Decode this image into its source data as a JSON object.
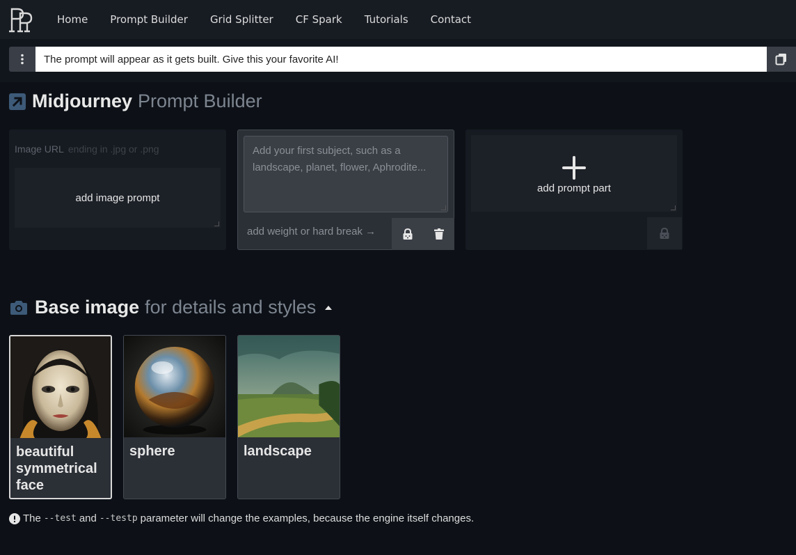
{
  "nav": {
    "items": [
      "Home",
      "Prompt Builder",
      "Grid Splitter",
      "CF Spark",
      "Tutorials",
      "Contact"
    ]
  },
  "prompt_bar": {
    "text": "The prompt will appear as it gets built. Give this your favorite AI!"
  },
  "builder": {
    "title_strong": "Midjourney",
    "title_muted": "Prompt Builder",
    "image_card": {
      "url_label": "Image URL",
      "url_placeholder": "ending in .jpg or .png",
      "add_label": "add image prompt"
    },
    "subject_card": {
      "placeholder": "Add your first subject, such as a landscape, planet, flower, Aphrodite...",
      "weight_label": "add weight or hard break →"
    },
    "add_part_card": {
      "label": "add prompt part"
    }
  },
  "base_image": {
    "title_strong": "Base image",
    "title_muted": "for details and styles",
    "items": [
      {
        "label": "beautiful symmetrical face",
        "selected": true
      },
      {
        "label": "sphere",
        "selected": false
      },
      {
        "label": "landscape",
        "selected": false
      }
    ]
  },
  "footnote": {
    "pre": "The",
    "code1": "--test",
    "mid": "and",
    "code2": "--testp",
    "post": "parameter will change the examples, because the engine itself changes."
  },
  "colors": {
    "background": "#0d1117",
    "navbar": "#171b22",
    "card": "#161a21",
    "card_active": "#2b2f36",
    "muted_text": "#7d8590",
    "icon_blue": "#3d5a78"
  }
}
